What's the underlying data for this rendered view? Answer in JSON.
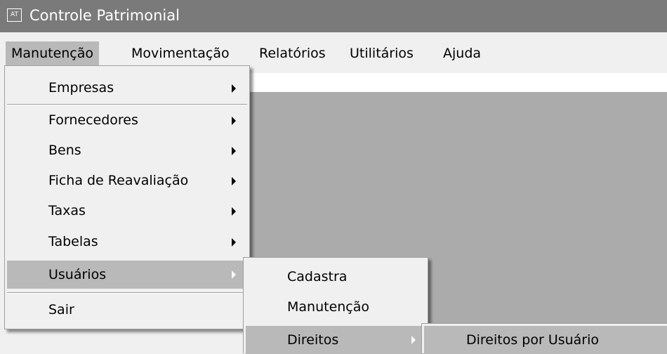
{
  "window": {
    "title": "Controle Patrimonial",
    "icon_text": "AT"
  },
  "menubar": {
    "items": [
      "Manutenção",
      "Movimentação",
      "Relatórios",
      "Utilitários",
      "Ajuda"
    ]
  },
  "menu_manutencao": {
    "items": [
      "Empresas",
      "Fornecedores",
      "Bens",
      "Ficha de Reavaliação",
      "Taxas",
      "Tabelas",
      "Usuários",
      "Sair"
    ]
  },
  "menu_usuarios": {
    "items": [
      "Cadastra",
      "Manutenção",
      "Direitos"
    ]
  },
  "menu_direitos": {
    "items": [
      "Direitos por Usuário"
    ]
  }
}
